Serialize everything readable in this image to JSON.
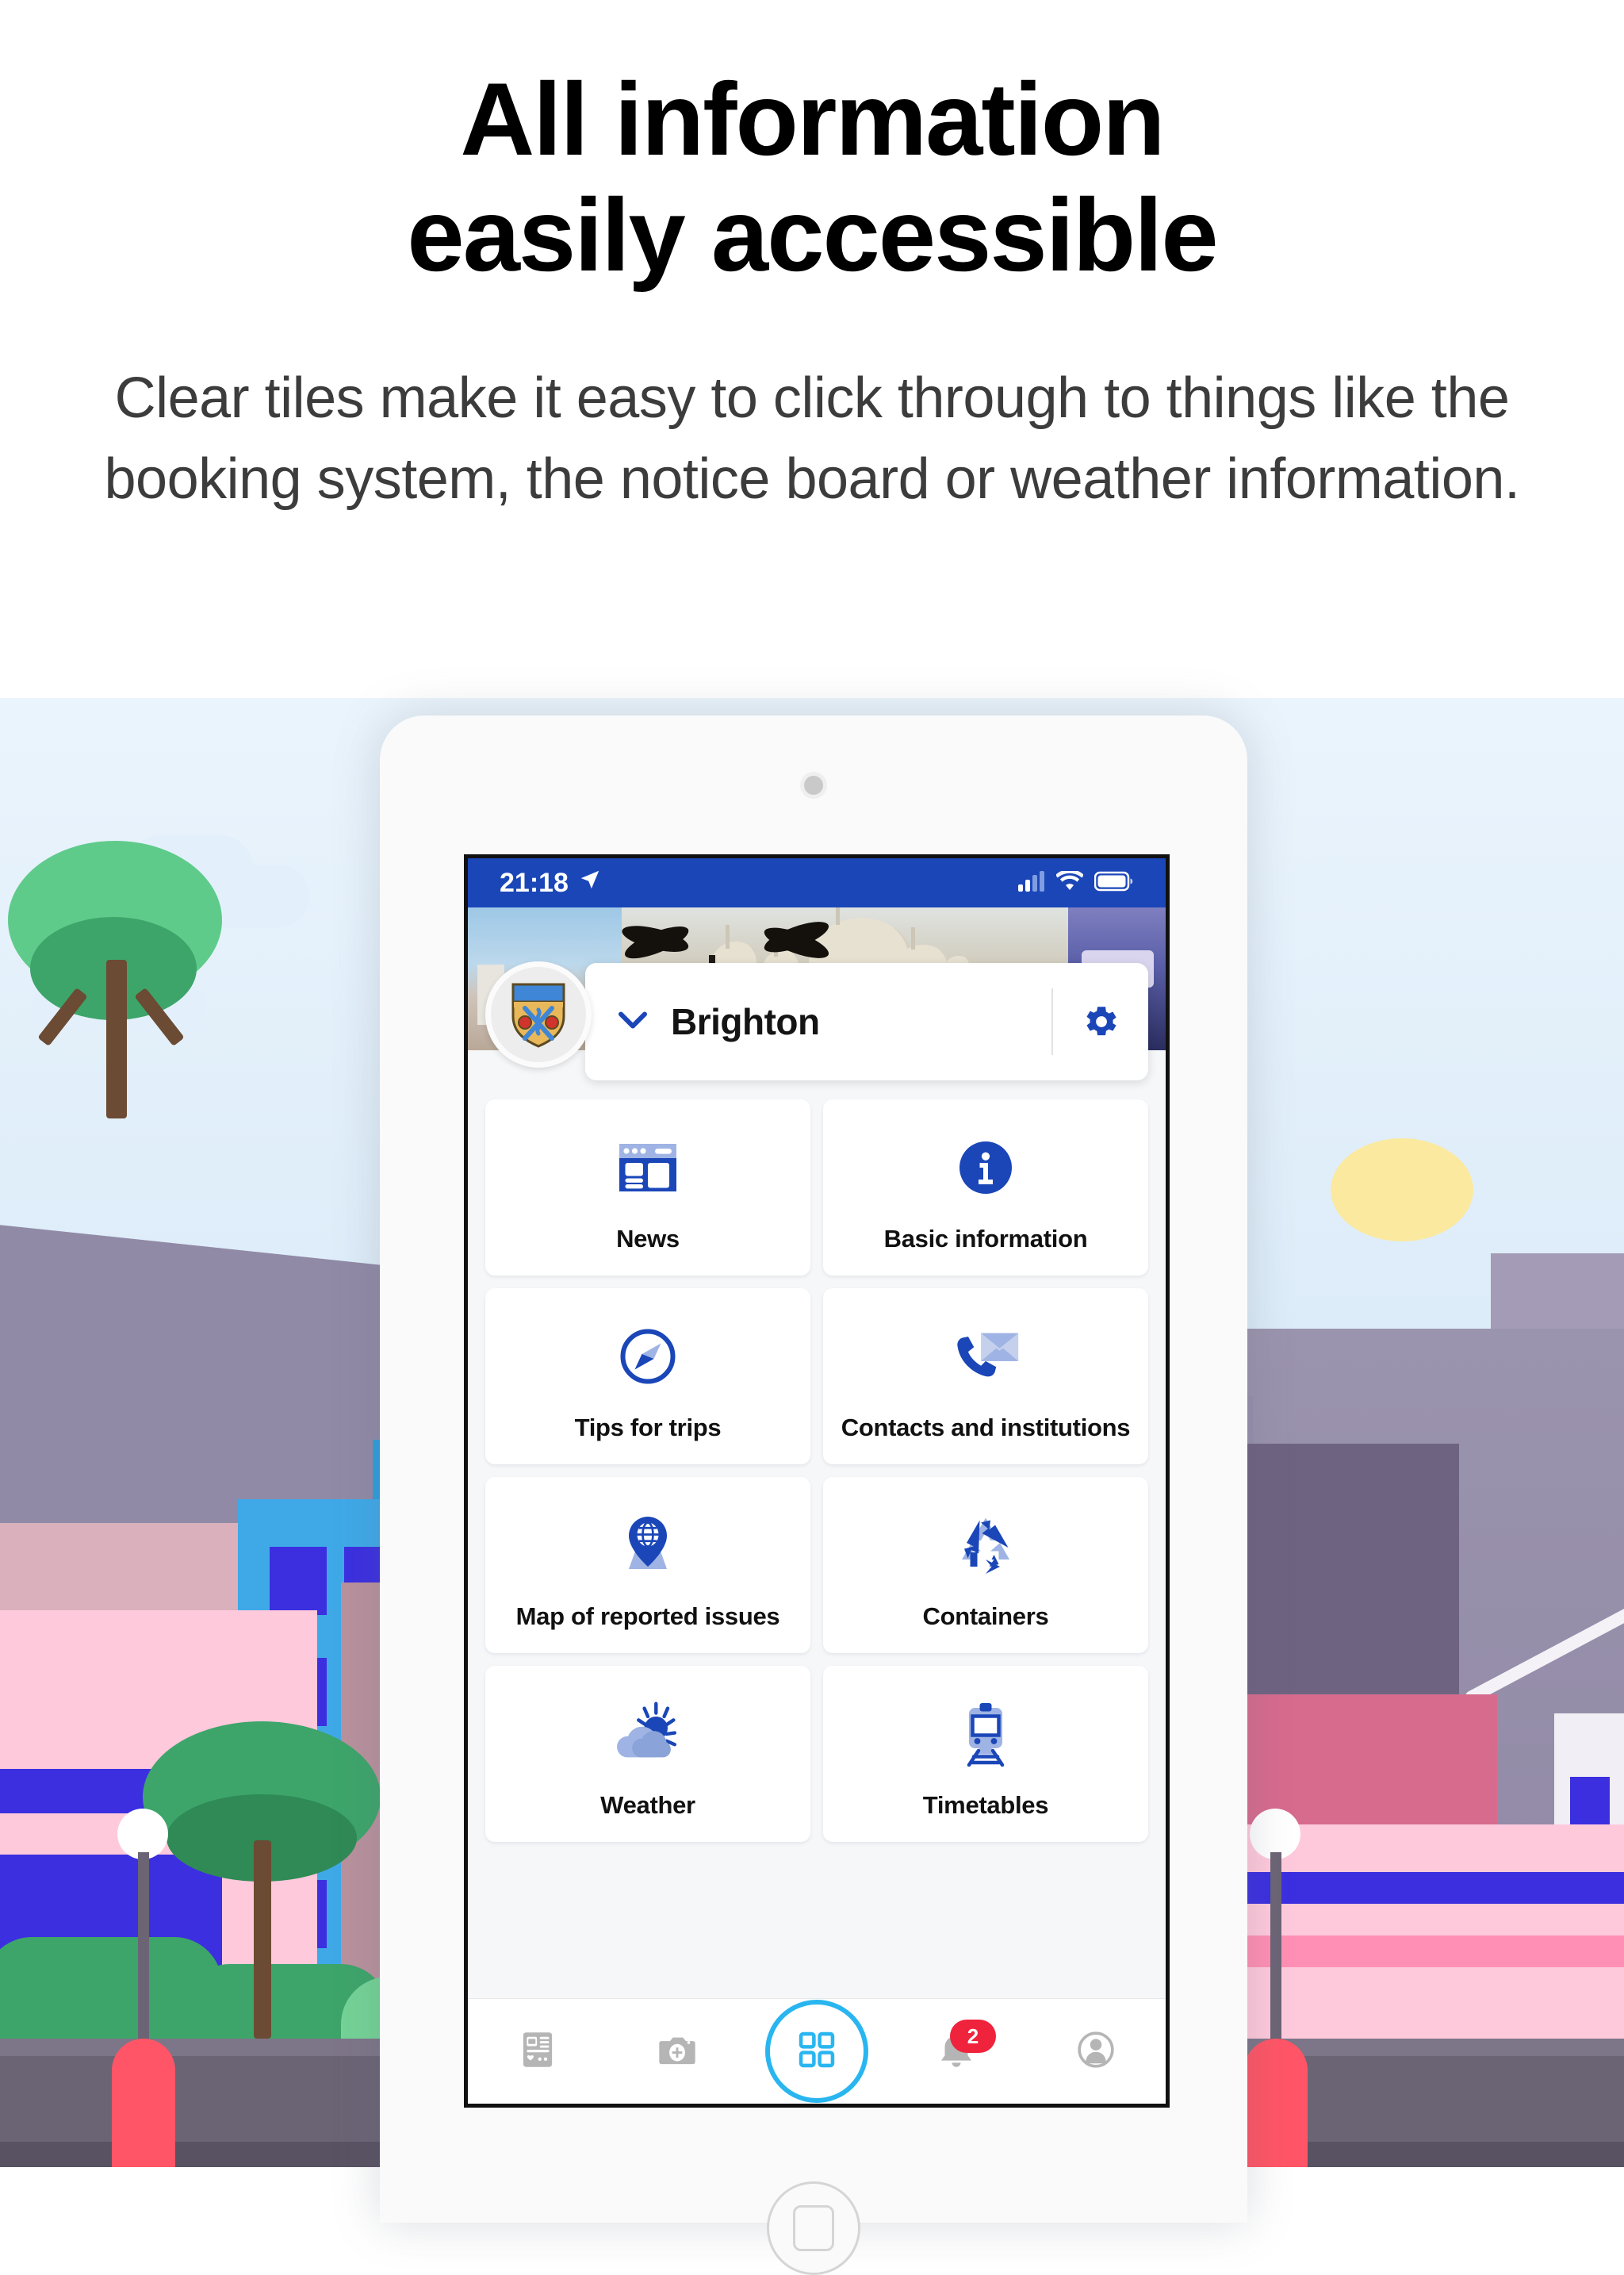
{
  "marketing": {
    "headline_line1": "All information",
    "headline_line2": "easily accessible",
    "subcopy": "Clear tiles make it easy to click through to things like the booking system, the notice board or weather information."
  },
  "device": {
    "type": "tablet-frame",
    "camera_icon": "front-camera-icon",
    "home_button_icon": "home-button-icon"
  },
  "app": {
    "status_bar": {
      "time": "21:18",
      "location_icon": "location-arrow-icon",
      "signal_icon": "cellular-signal-icon",
      "wifi_icon": "wifi-icon",
      "battery_icon": "battery-icon",
      "background_color": "#1a46b8"
    },
    "hero": {
      "alt": "Brighton Royal Pavilion photo strip",
      "panels": [
        "brighton-seafront-photo",
        "royal-pavilion-photo",
        "brighton-pier-photo"
      ]
    },
    "selector": {
      "badge_icon": "city-coat-of-arms-icon",
      "chevron_icon": "chevron-down-icon",
      "city": "Brighton",
      "settings_icon": "gear-icon"
    },
    "tiles": [
      {
        "label": "News",
        "icon": "news-layout-icon"
      },
      {
        "label": "Basic information",
        "icon": "info-circle-icon"
      },
      {
        "label": "Tips for trips",
        "icon": "compass-icon"
      },
      {
        "label": "Contacts and institutions",
        "icon": "phone-envelope-icon"
      },
      {
        "label": "Map of reported issues",
        "icon": "map-pin-globe-icon"
      },
      {
        "label": "Containers",
        "icon": "recycling-icon"
      },
      {
        "label": "Weather",
        "icon": "sun-cloud-icon"
      },
      {
        "label": "Timetables",
        "icon": "train-icon"
      }
    ],
    "bottom_nav": [
      {
        "name": "feed",
        "icon": "news-feed-icon",
        "active": false,
        "badge": ""
      },
      {
        "name": "report",
        "icon": "camera-add-icon",
        "active": false,
        "badge": ""
      },
      {
        "name": "tiles",
        "icon": "grid-tiles-icon",
        "active": true,
        "badge": ""
      },
      {
        "name": "notifications",
        "icon": "bell-icon",
        "active": false,
        "badge": "2"
      },
      {
        "name": "profile",
        "icon": "user-avatar-icon",
        "active": false,
        "badge": ""
      }
    ],
    "colors": {
      "primary_blue": "#1a46b8",
      "accent_cyan": "#29b6f0",
      "badge_red": "#f0233c",
      "icon_light_blue": "#9fb4e4"
    }
  }
}
